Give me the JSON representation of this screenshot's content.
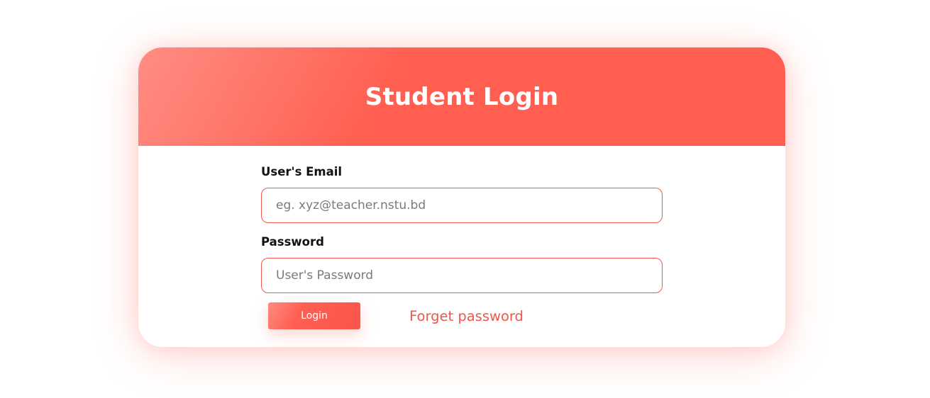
{
  "login_card": {
    "title": "Student Login",
    "email": {
      "label": "User's Email",
      "placeholder": "eg. xyz@teacher.nstu.bd",
      "value": ""
    },
    "password": {
      "label": "Password",
      "placeholder": "User's Password",
      "value": ""
    },
    "login_button_label": "Login",
    "forget_password_link": "Forget password"
  },
  "colors": {
    "accent": "#ff5e50",
    "accent_light": "#ff8d84",
    "border": "#f2564a",
    "label_text": "#111111",
    "placeholder_text": "#7a7a7a",
    "background": "#ffffff"
  }
}
